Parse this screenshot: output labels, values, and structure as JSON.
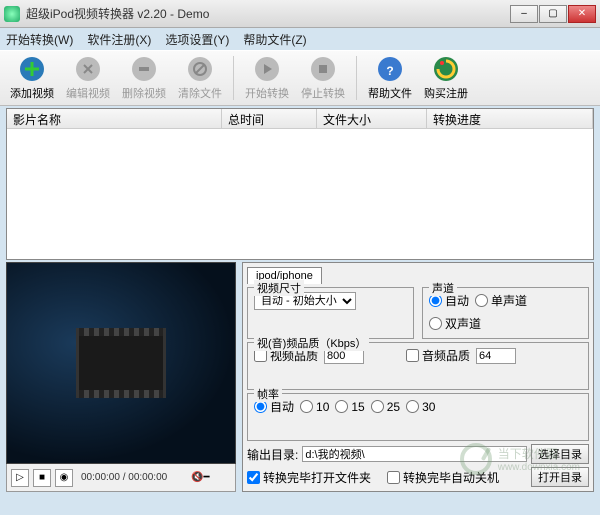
{
  "window": {
    "title": "超级iPod视频转换器 v2.20 - Demo"
  },
  "menu": {
    "start": "开始转换(W)",
    "register": "软件注册(X)",
    "options": "选项设置(Y)",
    "help": "帮助文件(Z)"
  },
  "toolbar": {
    "add": "添加视频",
    "edit": "编辑视频",
    "del": "删除视频",
    "clear": "清除文件",
    "start": "开始转换",
    "stop": "停止转换",
    "help": "帮助文件",
    "buy": "购买注册"
  },
  "list": {
    "columns": {
      "name": "影片名称",
      "duration": "总时间",
      "size": "文件大小",
      "progress": "转换进度"
    },
    "rows": []
  },
  "player": {
    "time": "00:00:00 / 00:00:00"
  },
  "settings": {
    "tab": "ipod/iphone",
    "videoSize": {
      "label": "视频尺寸",
      "value": "自动 - 初始大小"
    },
    "audio": {
      "label": "声道",
      "auto": "自动",
      "mono": "单声道",
      "stereo": "双声道"
    },
    "quality": {
      "label": "视(音)频品质（Kbps）",
      "vlabel": "视频品质",
      "vval": "800",
      "alabel": "音频品质",
      "aval": "64"
    },
    "fps": {
      "label": "帧率",
      "auto": "自动",
      "o10": "10",
      "o15": "15",
      "o25": "25",
      "o30": "30"
    },
    "output": {
      "label": "输出目录:",
      "path": "d:\\我的视频\\",
      "choose": "选择目录"
    },
    "postOpenFolder": "转换完毕打开文件夹",
    "postShutdown": "转换完毕自动关机",
    "openFolder": "打开目录"
  },
  "watermark": {
    "text": "当下软件园",
    "url": "www.downxia.com"
  }
}
